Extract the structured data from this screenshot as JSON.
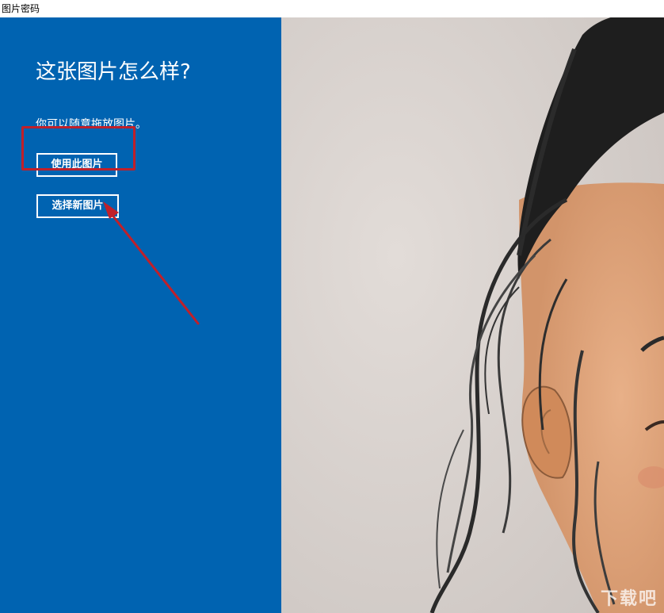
{
  "window": {
    "title": "图片密码"
  },
  "panel": {
    "heading": "这张图片怎么样?",
    "subtitle": "你可以随意拖放图片。",
    "use_button_label": "使用此图片",
    "choose_button_label": "选择新图片"
  },
  "colors": {
    "panel_background": "#0063b1",
    "annotation_red": "#c0202a",
    "button_border": "#ffffff"
  },
  "photo": {
    "watermark_text": "下载吧"
  }
}
